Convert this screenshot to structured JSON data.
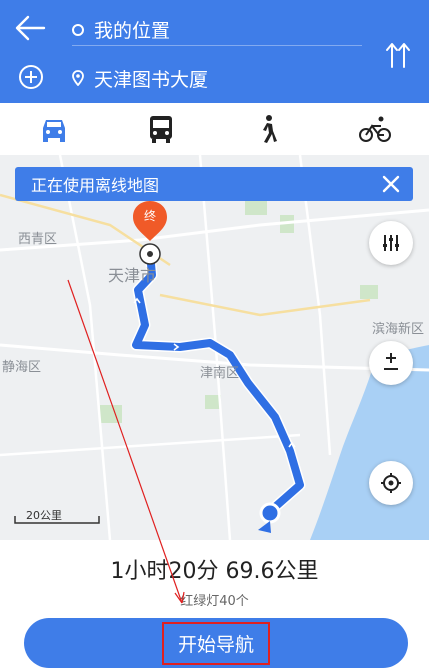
{
  "header": {
    "origin": "我的位置",
    "destination": "天津图书大厦"
  },
  "modes": [
    {
      "icon": "car-icon",
      "active": true
    },
    {
      "icon": "bus-icon",
      "active": false
    },
    {
      "icon": "walk-icon",
      "active": false
    },
    {
      "icon": "bike-icon",
      "active": false
    }
  ],
  "map": {
    "banner_text": "正在使用离线地图",
    "end_marker": "终",
    "scale_label": "20公里",
    "labels": {
      "xiqing": "西青区",
      "tianjin": "天津市",
      "binhai": "滨海新区",
      "jinghai": "静海区",
      "jinnan": "津南区"
    }
  },
  "summary": {
    "duration_distance": "1小时20分  69.6公里",
    "traffic_lights": "红绿灯40个"
  },
  "start_button": {
    "label": "开始导航"
  },
  "colors": {
    "primary": "#3f7de8",
    "route": "#2f6fe4",
    "end_marker": "#f05a28",
    "annotation": "#e02020"
  }
}
